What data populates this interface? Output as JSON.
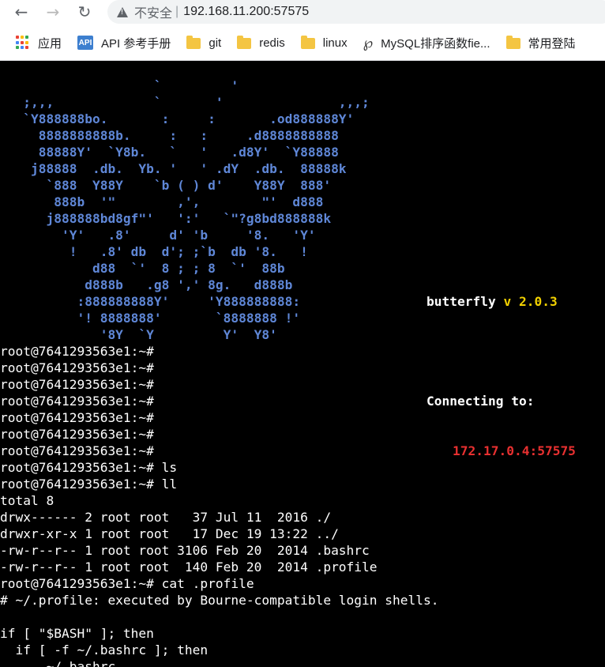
{
  "browser": {
    "back_icon": "arrow-left-icon",
    "forward_icon": "arrow-right-icon",
    "reload_icon": "reload-icon",
    "security_label": "不安全",
    "url": "192.168.11.200:57575"
  },
  "bookmarks": [
    {
      "label": "应用",
      "icon": "apps-grid-icon"
    },
    {
      "label": "API 参考手册",
      "icon": "api-icon"
    },
    {
      "label": "git",
      "icon": "folder-icon"
    },
    {
      "label": "redis",
      "icon": "folder-icon"
    },
    {
      "label": "linux",
      "icon": "folder-icon"
    },
    {
      "label": "MySQL排序函数fie...",
      "icon": "dolphin-icon"
    },
    {
      "label": "常用登陆",
      "icon": "folder-icon"
    }
  ],
  "terminal": {
    "banner_lines": [
      "                    `         '",
      "   ;,,,             `       '               ,,,;",
      "   `Y888888bo.       :     :       .od888888Y'",
      "     8888888888b.     :   :     .d8888888888",
      "     88888Y'  `Y8b.   `   '   .d8Y'  `Y88888",
      "    j88888  .db.  Yb. '   ' .dY  .db.  88888k",
      "      `888  Y88Y    `b ( ) d'    Y88Y  888'",
      "       888b  '\"        ,',        \"'  d888",
      "      j888888bd8gf\"'   ':'   `\"?g8bd888888k",
      "        'Y'   .8'     d' 'b     '8.   'Y'",
      "         !   .8' db  d'; ;`b  db '8.   !",
      "            d88  `'  8 ; ; 8  `'  88b",
      "           d888b   .g8 ',' 8g.   d888b",
      "          :888888888Y'     'Y888888888:",
      "          '! 8888888'       `8888888 !'",
      "             '8Y  `Y         Y'  Y8'"
    ],
    "app_name": "butterfly",
    "app_v": "v",
    "app_version": "2.0.3",
    "connecting_label": "Connecting to:",
    "connect_address": "172.17.0.4:57575",
    "output_lines": [
      "root@7641293563e1:~#",
      "root@7641293563e1:~#",
      "root@7641293563e1:~#",
      "root@7641293563e1:~#",
      "root@7641293563e1:~#",
      "root@7641293563e1:~#",
      "root@7641293563e1:~#",
      "root@7641293563e1:~# ls",
      "root@7641293563e1:~# ll",
      "total 8",
      "drwx------ 2 root root   37 Jul 11  2016 ./",
      "drwxr-xr-x 1 root root   17 Dec 19 13:22 ../",
      "-rw-r--r-- 1 root root 3106 Feb 20  2014 .bashrc",
      "-rw-r--r-- 1 root root  140 Feb 20  2014 .profile",
      "root@7641293563e1:~# cat .profile",
      "# ~/.profile: executed by Bourne-compatible login shells.",
      "",
      "if [ \"$BASH\" ]; then",
      "  if [ -f ~/.bashrc ]; then",
      "    . ~/.bashrc"
    ]
  }
}
